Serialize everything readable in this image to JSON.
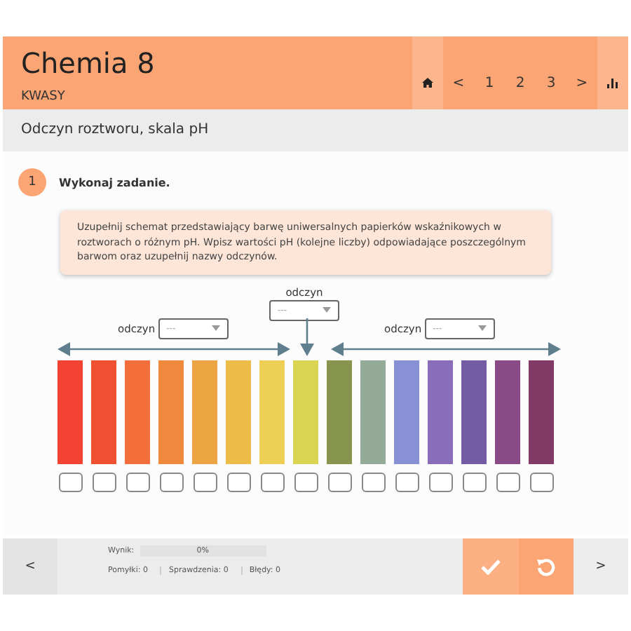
{
  "header": {
    "title": "Chemia 8",
    "subtitle": "KWASY",
    "nav": [
      {
        "kind": "home"
      },
      {
        "kind": "text",
        "label": "<"
      },
      {
        "kind": "text",
        "label": "1"
      },
      {
        "kind": "text",
        "label": "2"
      },
      {
        "kind": "text",
        "label": "3"
      },
      {
        "kind": "text",
        "label": ">"
      },
      {
        "kind": "stats"
      }
    ]
  },
  "section_title": "Odczyn roztworu, skala pH",
  "task": {
    "number": "1",
    "title": "Wykonaj zadanie.",
    "instruction": "Uzupełnij schemat przedstawiający barwę uniwersalnych papierków wskaźnikowych w roztworach o różnym pH. Wpisz wartości pH (kolejne liczby) odpowiadające poszczególnym barwom oraz uzupełnij nazwy odczynów."
  },
  "selects": [
    {
      "label": "odczyn",
      "value": "---"
    },
    {
      "label": "odczyn",
      "value": "---"
    },
    {
      "label": "odczyn",
      "value": "---"
    }
  ],
  "strips": [
    {
      "color": "#f44333"
    },
    {
      "color": "#f15032"
    },
    {
      "color": "#f46e3c"
    },
    {
      "color": "#f0893d"
    },
    {
      "color": "#eda543"
    },
    {
      "color": "#eebc48"
    },
    {
      "color": "#eecf55"
    },
    {
      "color": "#dad453"
    },
    {
      "color": "#87944e"
    },
    {
      "color": "#95ab9a"
    },
    {
      "color": "#8991d6"
    },
    {
      "color": "#8a6dba"
    },
    {
      "color": "#735ca3"
    },
    {
      "color": "#8a4a86"
    },
    {
      "color": "#823b67"
    }
  ],
  "footer": {
    "prev": "<",
    "next": ">",
    "score_label": "Wynik:",
    "score": "0%",
    "level": 0,
    "attempts": "Pomyłki: 0",
    "checks": "Sprawdzenia: 0",
    "errors": "Błędy: 0"
  }
}
